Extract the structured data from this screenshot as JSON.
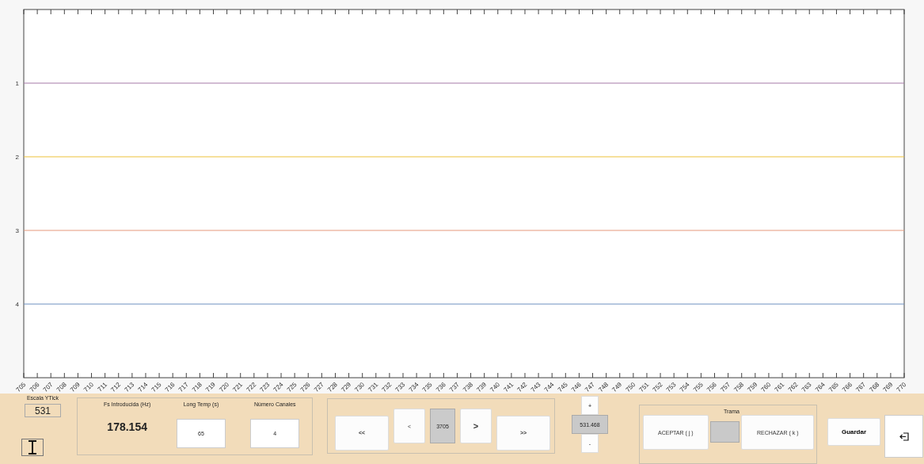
{
  "chart": {
    "chart_data": {
      "type": "line",
      "x": [
        705,
        770
      ],
      "xlim": [
        705,
        770
      ],
      "ylim": [
        5,
        0
      ],
      "xticks": [
        705,
        706,
        707,
        708,
        709,
        710,
        711,
        712,
        713,
        714,
        715,
        716,
        717,
        718,
        719,
        720,
        721,
        722,
        723,
        724,
        725,
        726,
        727,
        728,
        729,
        730,
        731,
        732,
        733,
        734,
        735,
        736,
        737,
        738,
        739,
        740,
        741,
        742,
        743,
        744,
        745,
        746,
        747,
        748,
        749,
        750,
        751,
        752,
        753,
        754,
        755,
        756,
        757,
        758,
        759,
        760,
        761,
        762,
        763,
        764,
        765,
        766,
        767,
        768,
        769,
        770
      ],
      "yticks": [
        1,
        2,
        3,
        4
      ],
      "series": [
        {
          "color": "#a57aa8",
          "values": [
            1,
            1
          ]
        },
        {
          "color": "#edc23a",
          "values": [
            2,
            2
          ]
        },
        {
          "color": "#e59a7c",
          "values": [
            3,
            3
          ]
        },
        {
          "color": "#6e8fbf",
          "values": [
            4,
            4
          ]
        }
      ]
    }
  },
  "controls": {
    "ytick_scale": {
      "label": "Escala YTick",
      "value": "531"
    },
    "info_panel": {
      "fs_label": "Fs Introducida (Hz)",
      "fs_value": "178.154",
      "length_label": "Long Temp (s)",
      "length_value": "65",
      "channels_label": "Número Canales",
      "channels_value": "4"
    },
    "navigation": [
      {
        "kind": "button",
        "label": "<<"
      },
      {
        "kind": "button",
        "label": "<"
      },
      {
        "kind": "display",
        "label": "3705"
      },
      {
        "kind": "button",
        "label": ">"
      },
      {
        "kind": "button",
        "label": ">>"
      }
    ],
    "zoom": {
      "plus": "+",
      "value": "531.468",
      "minus": "-"
    },
    "frame": {
      "title": "Trama",
      "accept": "ACEPTAR ( j )",
      "reject": "RECHAZAR ( k )"
    },
    "save": "Guardar"
  }
}
